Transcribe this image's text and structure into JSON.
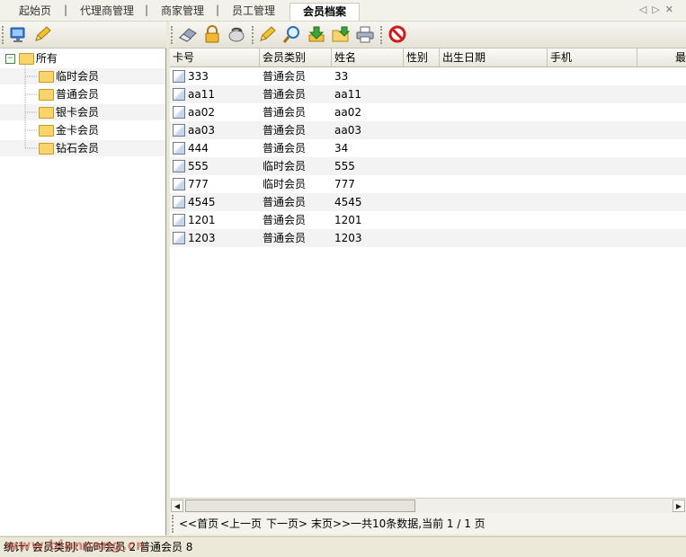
{
  "tabs": [
    {
      "label": "起始页"
    },
    {
      "label": "代理商管理"
    },
    {
      "label": "商家管理"
    },
    {
      "label": "员工管理"
    },
    {
      "label": "会员档案"
    }
  ],
  "tree": {
    "root": "所有",
    "items": [
      {
        "label": "临时会员"
      },
      {
        "label": "普通会员"
      },
      {
        "label": "银卡会员"
      },
      {
        "label": "金卡会员"
      },
      {
        "label": "钻石会员"
      }
    ]
  },
  "grid": {
    "columns": [
      "卡号",
      "会员类别",
      "姓名",
      "性别",
      "出生日期",
      "手机",
      "最"
    ],
    "rows": [
      {
        "card": "333",
        "type": "普通会员",
        "name": "33"
      },
      {
        "card": "aa11",
        "type": "普通会员",
        "name": "aa11"
      },
      {
        "card": "aa02",
        "type": "普通会员",
        "name": "aa02"
      },
      {
        "card": "aa03",
        "type": "普通会员",
        "name": "aa03"
      },
      {
        "card": "444",
        "type": "普通会员",
        "name": "34"
      },
      {
        "card": "555",
        "type": "临时会员",
        "name": "555"
      },
      {
        "card": "777",
        "type": "临时会员",
        "name": "777"
      },
      {
        "card": "4545",
        "type": "普通会员",
        "name": "4545"
      },
      {
        "card": "1201",
        "type": "普通会员",
        "name": "1201"
      },
      {
        "card": "1203",
        "type": "普通会员",
        "name": "1203"
      }
    ]
  },
  "pager": {
    "first": "<<首页",
    "prev": "<上一页",
    "next": "下一页>",
    "last": "末页>>",
    "info": "一共10条数据,当前 1 / 1 页"
  },
  "status": {
    "text": "统计: 会员类别: 临时会员 2 普通会员 8"
  },
  "watermark": "www.bianceng.cn"
}
